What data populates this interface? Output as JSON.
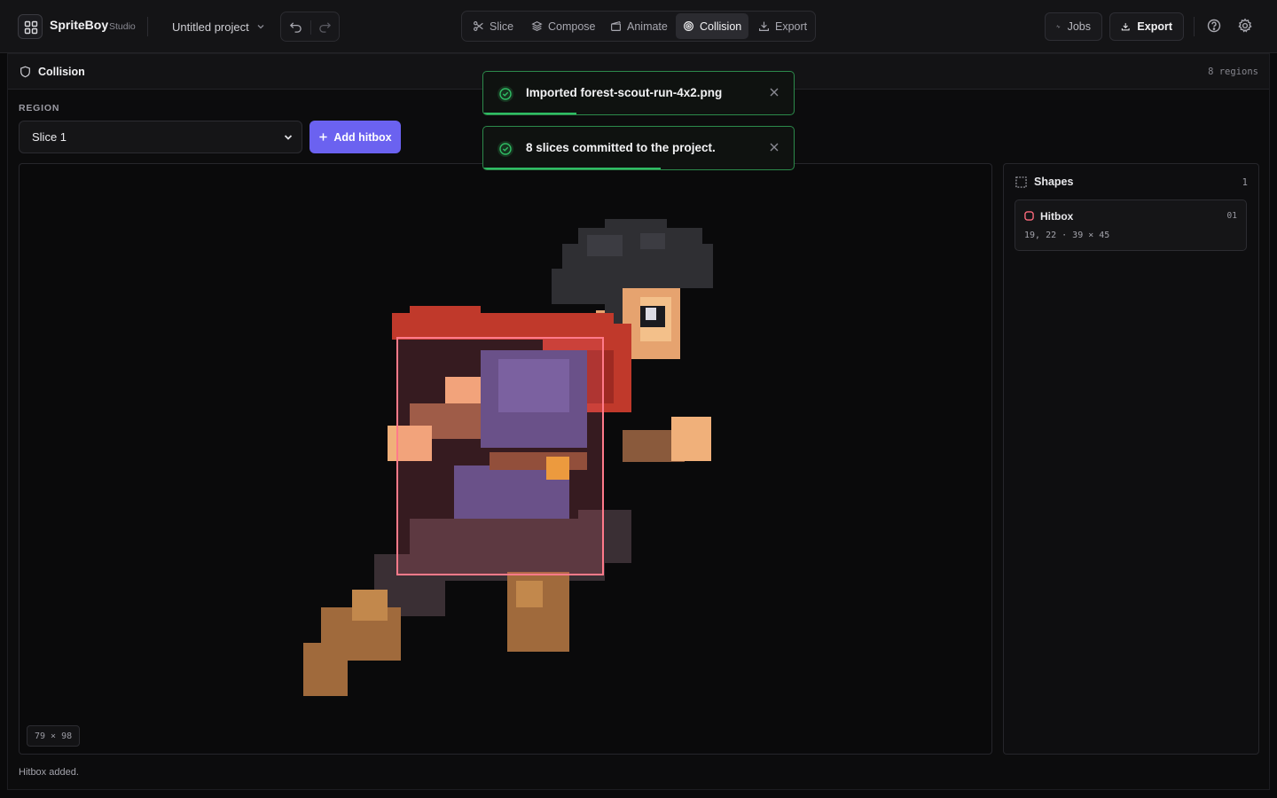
{
  "app": {
    "name": "SpriteBoy",
    "edition": "Studio",
    "project": "Untitled project"
  },
  "modes": [
    {
      "label": "Slice",
      "icon": "scissors-icon",
      "active": false
    },
    {
      "label": "Compose",
      "icon": "layers-icon",
      "active": false
    },
    {
      "label": "Animate",
      "icon": "film-icon",
      "active": false
    },
    {
      "label": "Collision",
      "icon": "target-icon",
      "active": true
    },
    {
      "label": "Export",
      "icon": "export-icon",
      "active": false
    }
  ],
  "toolbar": {
    "jobs_label": "Jobs",
    "export_label": "Export"
  },
  "panel": {
    "title": "Collision",
    "region_count": "8 regions",
    "region_label": "REGION",
    "region_value": "Slice 1",
    "add_hitbox_label": "Add hitbox",
    "canvas_dims": "79 × 98",
    "status": "Hitbox added."
  },
  "shapes": {
    "title": "Shapes",
    "count": "1",
    "items": [
      {
        "name": "Hitbox",
        "id": "01",
        "meta": "19, 22 · 39 × 45"
      }
    ]
  },
  "toasts": [
    {
      "message": "Imported forest-scout-run-4x2.png",
      "progress": 0.3
    },
    {
      "message": "8 slices committed to the project.",
      "progress": 0.57
    }
  ],
  "colors": {
    "accent": "#6b62f0",
    "hitbox": "#ff6b7d",
    "success": "#2fbd64"
  }
}
